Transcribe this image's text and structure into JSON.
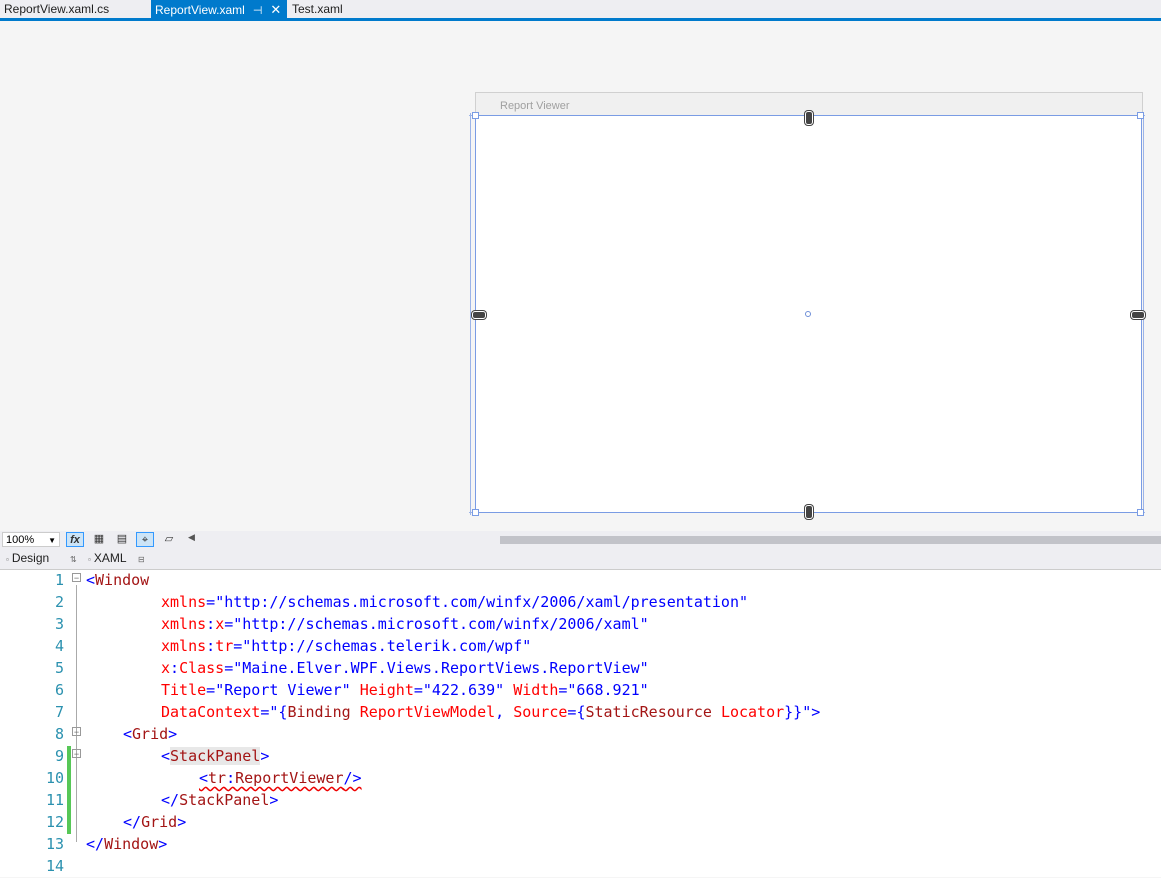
{
  "tabs": [
    {
      "label": "ReportView.xaml.cs"
    },
    {
      "label": "ReportView.xaml",
      "active": true
    },
    {
      "label": "Test.xaml"
    }
  ],
  "icons": {
    "pin": "pin-icon",
    "close": "close-icon"
  },
  "designer": {
    "window_title": "Report Viewer"
  },
  "toolbar": {
    "zoom": "100%"
  },
  "view_tabs": {
    "design": "Design",
    "xaml": "XAML"
  },
  "colors": {
    "accent": "#007acc",
    "change_bar": "#57c757"
  },
  "code_lines": [
    {
      "n": "1"
    },
    {
      "n": "2"
    },
    {
      "n": "3"
    },
    {
      "n": "4"
    },
    {
      "n": "5"
    },
    {
      "n": "6"
    },
    {
      "n": "7"
    },
    {
      "n": "8"
    },
    {
      "n": "9"
    },
    {
      "n": "10"
    },
    {
      "n": "11"
    },
    {
      "n": "12"
    },
    {
      "n": "13"
    },
    {
      "n": "14"
    }
  ],
  "code": {
    "l1": {
      "lt": "<",
      "tag": "Window"
    },
    "l2": {
      "attr": "xmlns",
      "eq": "=",
      "val": "\"http://schemas.microsoft.com/winfx/2006/xaml/presentation\""
    },
    "l3": {
      "pfx": "xmlns",
      "colon": ":",
      "attr": "x",
      "eq": "=",
      "val": "\"http://schemas.microsoft.com/winfx/2006/xaml\""
    },
    "l4": {
      "pfx": "xmlns",
      "colon": ":",
      "attr": "tr",
      "eq": "=",
      "val": "\"http://schemas.telerik.com/wpf\""
    },
    "l5": {
      "pfx": "x",
      "colon": ":",
      "attr": "Class",
      "eq": "=",
      "val": "\"Maine.Elver.WPF.Views.ReportViews.ReportView\""
    },
    "l6": {
      "a1": "Title",
      "v1": "\"Report Viewer\"",
      "a2": "Height",
      "v2": "\"422.639\"",
      "a3": "Width",
      "v3": "\"668.921\"",
      "eq": "="
    },
    "l7": {
      "attr": "DataContext",
      "eq": "=",
      "q": "\"",
      "brace_open": "{",
      "ext": "Binding",
      "sp1": " ",
      "arg": "ReportViewModel",
      "comma": ", ",
      "src": "Source",
      "eq2": "=",
      "inner_open": "{",
      "res": "StaticResource",
      "sp2": " ",
      "key": "Locator",
      "close": "}}",
      "q2": "\"",
      "end": ">"
    },
    "l8": {
      "lt": "<",
      "tag": "Grid",
      "gt": ">"
    },
    "l9": {
      "lt": "<",
      "tag": "StackPanel",
      "gt": ">"
    },
    "l10": {
      "lt": "<",
      "pfx": "tr",
      "colon": ":",
      "tag": "ReportViewer",
      "end": "/>"
    },
    "l11": {
      "lt": "</",
      "tag": "StackPanel",
      "gt": ">"
    },
    "l12": {
      "lt": "</",
      "tag": "Grid",
      "gt": ">"
    },
    "l13": {
      "lt": "</",
      "tag": "Window",
      "gt": ">"
    }
  }
}
